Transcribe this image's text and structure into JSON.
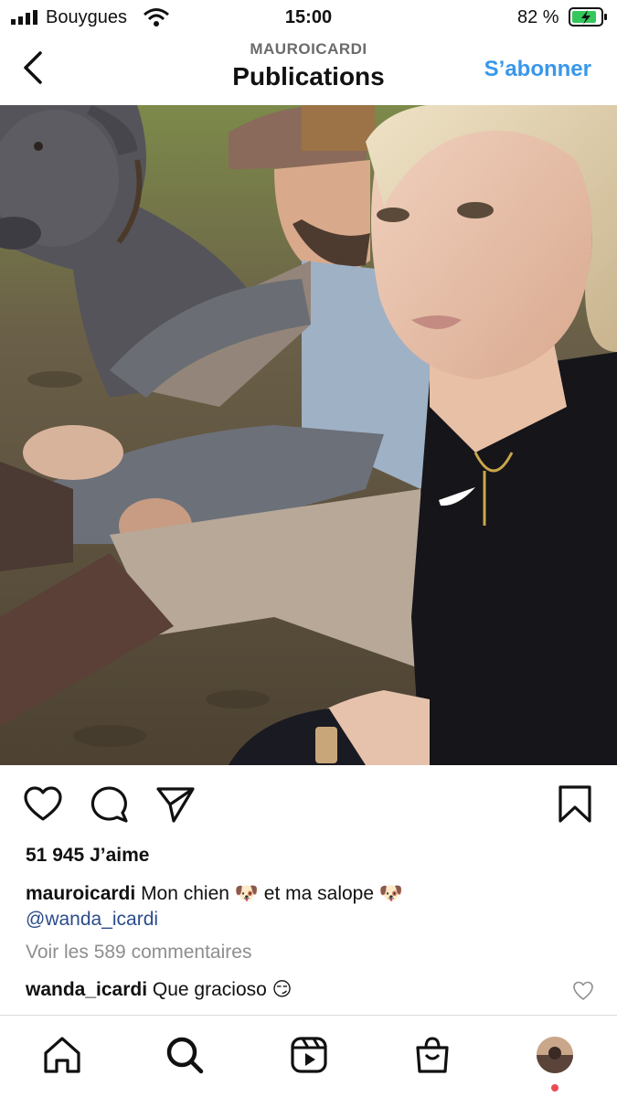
{
  "status_bar": {
    "carrier": "Bouygues",
    "time": "15:00",
    "battery": "82 %"
  },
  "header": {
    "username": "MAUROICARDI",
    "title": "Publications",
    "follow_label": "S’abonner"
  },
  "post": {
    "likes": "51 945 J’aime",
    "caption_user": "mauroicardi",
    "caption_text_1": "Mon chien",
    "caption_text_2": "et ma salope",
    "emoji": "🐶",
    "mention": "@wanda_icardi",
    "view_comments": "Voir les 589 commentaires",
    "comment_user": "wanda_icardi",
    "comment_text": "Que gracioso",
    "comment_emoji": "😏"
  },
  "icons": {
    "back": "chevron-left-icon",
    "like": "heart-icon",
    "comment": "comment-icon",
    "share": "send-icon",
    "save": "bookmark-icon",
    "home": "home-icon",
    "search": "search-icon",
    "reels": "reels-icon",
    "shop": "shop-icon"
  },
  "colors": {
    "accent": "#3a97ea",
    "mention": "#2b4c8c",
    "muted": "#8e8e8e",
    "notification": "#ed4956"
  }
}
